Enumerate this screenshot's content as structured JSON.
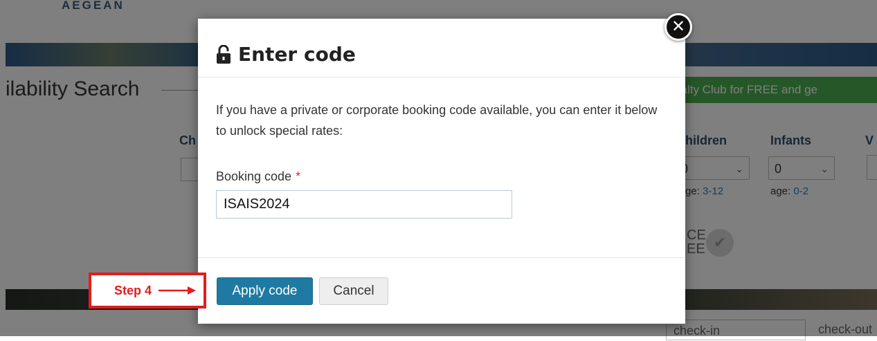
{
  "background": {
    "brand": "AEGEAN",
    "search_title": "ilability Search",
    "loyalty_banner": "yalty Club for FREE and ge",
    "labels": {
      "partial_left": "Ch",
      "children": "hildren",
      "infants": "Infants",
      "partial_right": "V"
    },
    "children_select": "0",
    "infants_select": "0",
    "children_age": {
      "prefix": "ge: ",
      "range": "3-12"
    },
    "infants_age": {
      "prefix": "age: ",
      "range": "0-2"
    },
    "badge_text": "CE\nEE",
    "checkin": "check-in",
    "checkout": "check-out"
  },
  "modal": {
    "title": "Enter code",
    "body": "If you have a private or corporate booking code available, you can enter it below to unlock special rates:",
    "field_label": "Booking code",
    "required_mark": "*",
    "code_value": "ISAIS2024",
    "apply_label": "Apply code",
    "cancel_label": "Cancel",
    "close_glyph": "✕"
  },
  "annotation": {
    "step_label": "Step 4"
  },
  "colors": {
    "accent": "#1e7aa2",
    "annotation": "#e21d1d",
    "loyalty": "#4caf50"
  }
}
